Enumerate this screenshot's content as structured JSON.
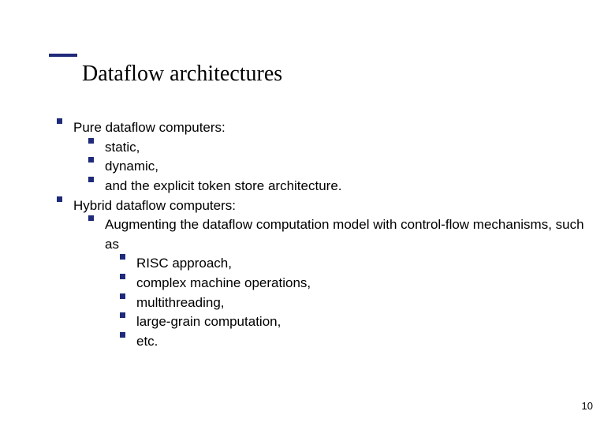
{
  "slide": {
    "title": "Dataflow architectures",
    "page_number": "10"
  },
  "outline": {
    "items": [
      {
        "level": 1,
        "text": "Pure dataflow computers:"
      },
      {
        "level": 2,
        "text": "static,"
      },
      {
        "level": 2,
        "text": "dynamic,"
      },
      {
        "level": 2,
        "text": "and the explicit token store architecture."
      },
      {
        "level": 1,
        "text": "Hybrid dataflow computers:"
      },
      {
        "level": 2,
        "text": "Augmenting the dataflow computation model with control-flow mechanisms, such as"
      },
      {
        "level": 3,
        "text": "RISC approach,"
      },
      {
        "level": 3,
        "text": "complex machine operations,"
      },
      {
        "level": 3,
        "text": "multithreading,"
      },
      {
        "level": 3,
        "text": "large-grain computation,"
      },
      {
        "level": 3,
        "text": "etc."
      }
    ]
  },
  "colors": {
    "accent": "#1f2a7a"
  }
}
